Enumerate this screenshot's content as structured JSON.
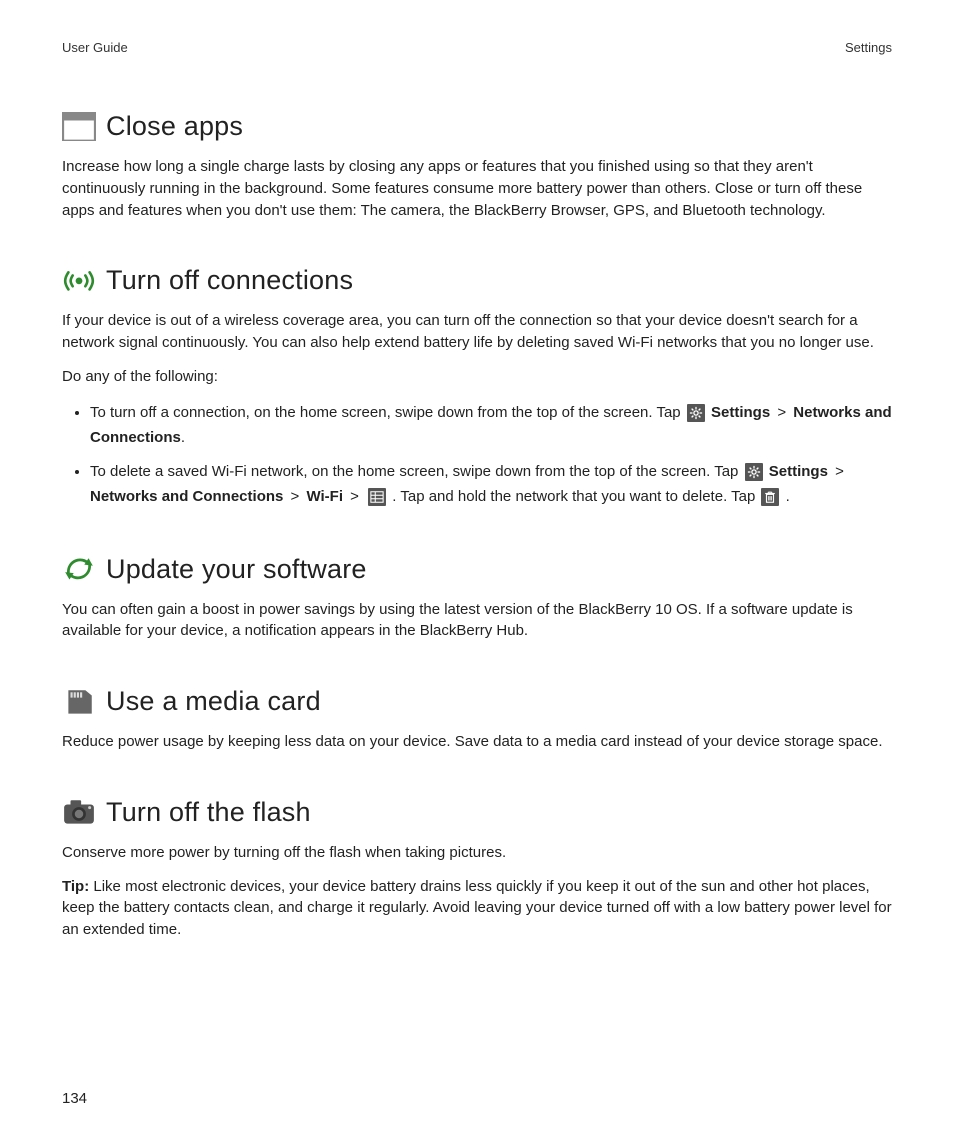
{
  "header": {
    "left": "User Guide",
    "right": "Settings"
  },
  "pageNumber": "134",
  "sep": ">",
  "labels": {
    "settings": "Settings",
    "networks_and_connections": "Networks and Connections",
    "wifi": "Wi-Fi",
    "tip": "Tip:"
  },
  "sections": {
    "close_apps": {
      "title": "Close apps",
      "body": "Increase how long a single charge lasts by closing any apps or features that you finished using so that they aren't continuously running in the background. Some features consume more battery power than others. Close or turn off these apps and features when you don't use them: The camera, the BlackBerry Browser, GPS, and Bluetooth technology."
    },
    "turn_off_connections": {
      "title": "Turn off connections",
      "body": "If your device is out of a wireless coverage area, you can turn off the connection so that your device doesn't search for a network signal continuously. You can also help extend battery life by deleting saved Wi-Fi networks that you no longer use.",
      "do_any": "Do any of the following:",
      "bullet1_a": "To turn off a connection, on the home screen, swipe down from the top of the screen. Tap ",
      "bullet1_b": "and Connections",
      "bullet1_c": ".",
      "bullet2_a": "To delete a saved Wi-Fi network, on the home screen, swipe down from the top of the screen. Tap ",
      "bullet2_b": ". Tap and hold the network that you want to delete. Tap ",
      "bullet2_c": "."
    },
    "update_software": {
      "title": "Update your software",
      "body": "You can often gain a boost in power savings by using the latest version of the BlackBerry 10 OS. If a software update is available for your device, a notification appears in the BlackBerry Hub."
    },
    "media_card": {
      "title": "Use a media card",
      "body": "Reduce power usage by keeping less data on your device. Save data to a media card instead of your device storage space."
    },
    "flash": {
      "title": "Turn off the flash",
      "body": "Conserve more power by turning off the flash when taking pictures.",
      "tip_body": " Like most electronic devices, your device battery drains less quickly if you keep it out of the sun and other hot places, keep the battery contacts clean, and charge it regularly. Avoid leaving your device turned off with a low battery power level for an extended time."
    }
  }
}
